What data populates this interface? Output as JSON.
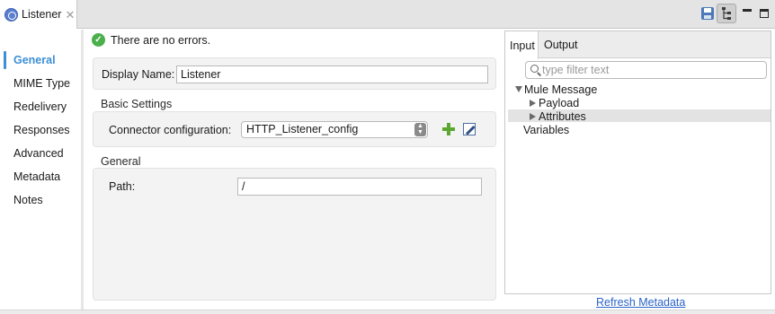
{
  "tab": {
    "title": "Listener",
    "close": "✕"
  },
  "nav": {
    "items": [
      {
        "label": "General",
        "active": true
      },
      {
        "label": "MIME Type"
      },
      {
        "label": "Redelivery"
      },
      {
        "label": "Responses"
      },
      {
        "label": "Advanced"
      },
      {
        "label": "Metadata"
      },
      {
        "label": "Notes"
      }
    ]
  },
  "status": {
    "message": "There are no errors.",
    "icon": "check-circle-icon"
  },
  "form": {
    "display_name_label": "Display Name:",
    "display_name_value": "Listener",
    "basic_settings_heading": "Basic Settings",
    "connector_label": "Connector configuration:",
    "connector_value": "HTTP_Listener_config",
    "general_heading": "General",
    "path_label": "Path:",
    "path_value": "/"
  },
  "metadata_pane": {
    "tabs": [
      "Input",
      "Output"
    ],
    "filter_placeholder": "type filter text",
    "tree": {
      "root": "Mule Message",
      "children": [
        "Payload",
        "Attributes"
      ],
      "sibling": "Variables"
    },
    "refresh_link": "Refresh Metadata"
  },
  "colors": {
    "accent": "#3d8fd6",
    "link": "#2a63c8",
    "ok": "#4bb04b",
    "add": "#5aa832"
  }
}
